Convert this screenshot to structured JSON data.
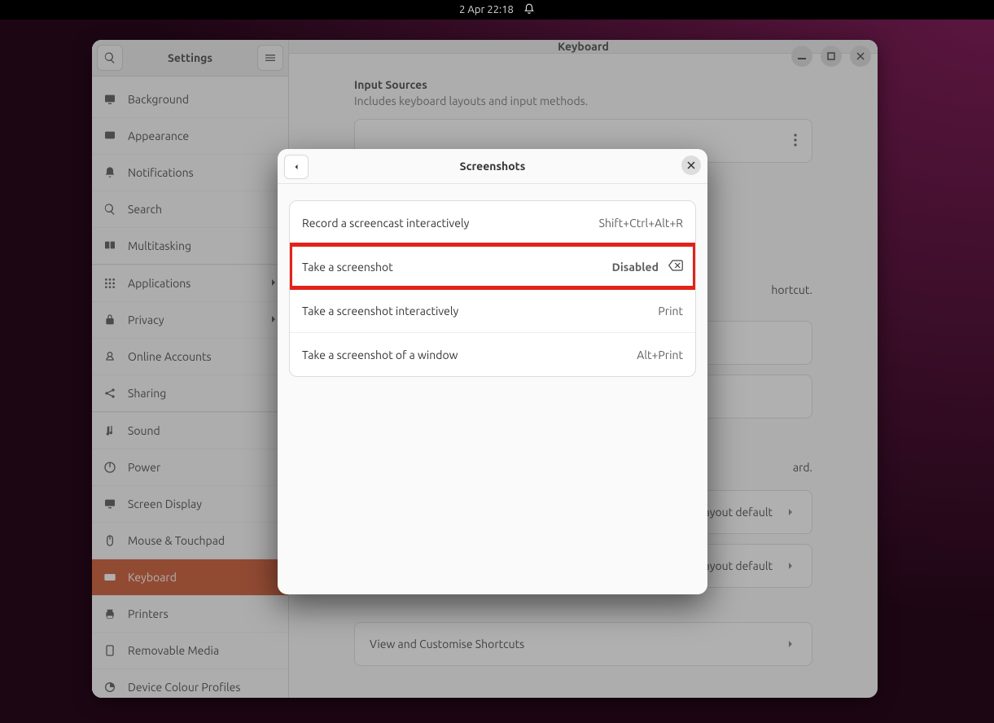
{
  "topbar": {
    "datetime": "2 Apr  22:18"
  },
  "sidebar": {
    "title": "Settings",
    "items": {
      "background": "Background",
      "appearance": "Appearance",
      "notifications": "Notifications",
      "search": "Search",
      "multitasking": "Multitasking",
      "applications": "Applications",
      "privacy": "Privacy",
      "online_accounts": "Online Accounts",
      "sharing": "Sharing",
      "sound": "Sound",
      "power": "Power",
      "screen_display": "Screen Display",
      "mouse_touchpad": "Mouse & Touchpad",
      "keyboard": "Keyboard",
      "printers": "Printers",
      "removable_media": "Removable Media",
      "colour": "Device Colour Profiles"
    }
  },
  "content": {
    "header_title": "Keyboard",
    "input_sources_title": "Input Sources",
    "input_sources_sub": "Includes keyboard layouts and input methods.",
    "hint_fragment": "hortcut.",
    "board_fragment": "ard.",
    "layout_default_1": "Layout default",
    "layout_default_2": "Layout default",
    "view_customise": "View and Customise Shortcuts"
  },
  "dialog": {
    "title": "Screenshots",
    "rows": {
      "r1_label": "Record a screencast interactively",
      "r1_value": "Shift+Ctrl+Alt+R",
      "r2_label": "Take a screenshot",
      "r2_value": "Disabled",
      "r3_label": "Take a screenshot interactively",
      "r3_value": "Print",
      "r4_label": "Take a screenshot of a window",
      "r4_value": "Alt+Print"
    }
  }
}
